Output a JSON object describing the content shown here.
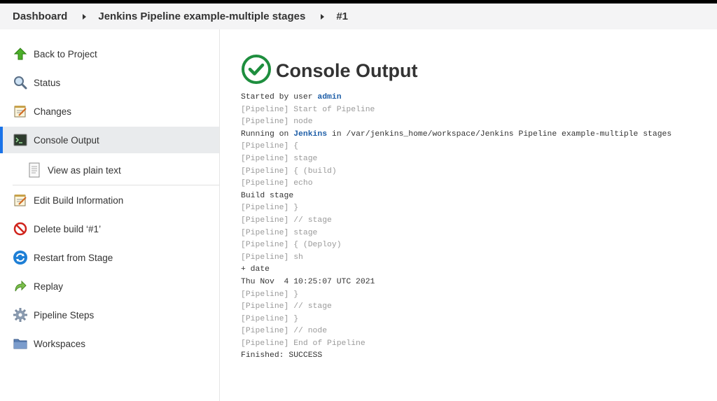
{
  "breadcrumb": {
    "items": [
      "Dashboard",
      "Jenkins Pipeline example-multiple stages",
      "#1"
    ]
  },
  "sidebar": {
    "items": [
      {
        "label": "Back to Project",
        "icon": "up-arrow-icon"
      },
      {
        "label": "Status",
        "icon": "magnifier-icon"
      },
      {
        "label": "Changes",
        "icon": "notepad-icon"
      },
      {
        "label": "Console Output",
        "icon": "terminal-icon",
        "active": true
      },
      {
        "label": "View as plain text",
        "icon": "document-icon",
        "sub": true
      },
      {
        "label": "Edit Build Information",
        "icon": "notepad-icon"
      },
      {
        "label": "Delete build ‘#1’",
        "icon": "no-entry-icon"
      },
      {
        "label": "Restart from Stage",
        "icon": "refresh-icon"
      },
      {
        "label": "Replay",
        "icon": "replay-arrow-icon"
      },
      {
        "label": "Pipeline Steps",
        "icon": "gear-icon"
      },
      {
        "label": "Workspaces",
        "icon": "folder-icon"
      }
    ]
  },
  "main": {
    "title": "Console Output",
    "status_color": "#1e8e3e"
  },
  "console": {
    "started_prefix": "Started by user ",
    "started_user": "admin",
    "running_prefix": "Running on ",
    "running_node": "Jenkins",
    "running_suffix": " in /var/jenkins_home/workspace/Jenkins Pipeline example-multiple stages",
    "lines": [
      {
        "text": "[Pipeline] Start of Pipeline",
        "dim": true
      },
      {
        "text": "[Pipeline] node",
        "dim": true
      },
      {
        "text": "[Pipeline] {",
        "dim": true
      },
      {
        "text": "[Pipeline] stage",
        "dim": true
      },
      {
        "text": "[Pipeline] { (build)",
        "dim": true
      },
      {
        "text": "[Pipeline] echo",
        "dim": true
      },
      {
        "text": "Build stage",
        "dim": false
      },
      {
        "text": "[Pipeline] }",
        "dim": true
      },
      {
        "text": "[Pipeline] // stage",
        "dim": true
      },
      {
        "text": "[Pipeline] stage",
        "dim": true
      },
      {
        "text": "[Pipeline] { (Deploy)",
        "dim": true
      },
      {
        "text": "[Pipeline] sh",
        "dim": true
      },
      {
        "text": "+ date",
        "dim": false
      },
      {
        "text": "Thu Nov  4 10:25:07 UTC 2021",
        "dim": false
      },
      {
        "text": "[Pipeline] }",
        "dim": true
      },
      {
        "text": "[Pipeline] // stage",
        "dim": true
      },
      {
        "text": "[Pipeline] }",
        "dim": true
      },
      {
        "text": "[Pipeline] // node",
        "dim": true
      },
      {
        "text": "[Pipeline] End of Pipeline",
        "dim": true
      },
      {
        "text": "Finished: SUCCESS",
        "dim": false
      }
    ]
  }
}
